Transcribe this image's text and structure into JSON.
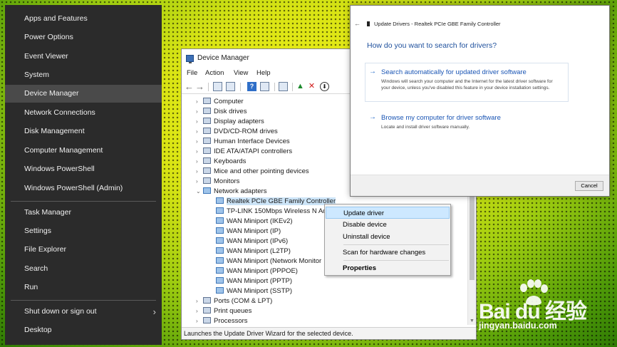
{
  "winx_menu": {
    "items": [
      {
        "label": "Apps and Features"
      },
      {
        "label": "Power Options"
      },
      {
        "label": "Event Viewer"
      },
      {
        "label": "System"
      },
      {
        "label": "Device Manager"
      },
      {
        "label": "Network Connections"
      },
      {
        "label": "Disk Management"
      },
      {
        "label": "Computer Management"
      },
      {
        "label": "Windows PowerShell"
      },
      {
        "label": "Windows PowerShell (Admin)"
      },
      {
        "label": "Task Manager"
      },
      {
        "label": "Settings"
      },
      {
        "label": "File Explorer"
      },
      {
        "label": "Search"
      },
      {
        "label": "Run"
      },
      {
        "label": "Shut down or sign out"
      },
      {
        "label": "Desktop"
      }
    ],
    "active_item": "Device Manager"
  },
  "device_manager": {
    "title": "Device Manager",
    "menu": [
      "File",
      "Action",
      "View",
      "Help"
    ],
    "tree": [
      {
        "label": "Computer",
        "expander": "›"
      },
      {
        "label": "Disk drives",
        "expander": "›"
      },
      {
        "label": "Display adapters",
        "expander": "›"
      },
      {
        "label": "DVD/CD-ROM drives",
        "expander": "›"
      },
      {
        "label": "Human Interface Devices",
        "expander": "›"
      },
      {
        "label": "IDE ATA/ATAPI controllers",
        "expander": "›"
      },
      {
        "label": "Keyboards",
        "expander": "›"
      },
      {
        "label": "Mice and other pointing devices",
        "expander": "›"
      },
      {
        "label": "Monitors",
        "expander": "›"
      },
      {
        "label": "Network adapters",
        "expander": "⌄"
      },
      {
        "label": "Realtek PCIe GBE Family Controller",
        "child": true
      },
      {
        "label": "TP-LINK 150Mbps Wireless N Ada",
        "child": true
      },
      {
        "label": "WAN Miniport (IKEv2)",
        "child": true
      },
      {
        "label": "WAN Miniport (IP)",
        "child": true
      },
      {
        "label": "WAN Miniport (IPv6)",
        "child": true
      },
      {
        "label": "WAN Miniport (L2TP)",
        "child": true
      },
      {
        "label": "WAN Miniport (Network Monitor",
        "child": true
      },
      {
        "label": "WAN Miniport (PPPOE)",
        "child": true
      },
      {
        "label": "WAN Miniport (PPTP)",
        "child": true
      },
      {
        "label": "WAN Miniport (SSTP)",
        "child": true
      },
      {
        "label": "Ports (COM & LPT)",
        "expander": "›"
      },
      {
        "label": "Print queues",
        "expander": "›"
      },
      {
        "label": "Processors",
        "expander": "›"
      }
    ],
    "selected_item": "Realtek PCIe GBE Family Controller",
    "status_text": "Launches the Update Driver Wizard for the selected device."
  },
  "context_menu": {
    "items": [
      {
        "label": "Update driver"
      },
      {
        "label": "Disable device"
      },
      {
        "label": "Uninstall device"
      },
      {
        "label": "Scan for hardware changes"
      },
      {
        "label": "Properties"
      }
    ],
    "highlighted": "Update driver"
  },
  "update_dialog": {
    "title": "Update Drivers - Realtek PCIe GBE Family Controller",
    "question": "How do you want to search for drivers?",
    "option_auto": {
      "title": "Search automatically for updated driver software",
      "description": "Windows will search your computer and the Internet for the latest driver software for your device, unless you've disabled this feature in your device installation settings."
    },
    "option_browse": {
      "title": "Browse my computer for driver software",
      "description": "Locate and install driver software manually."
    },
    "cancel_label": "Cancel"
  },
  "watermark": {
    "brand": "Bai du 经验",
    "url": "jingyan.baidu.com"
  },
  "colors": {
    "menu_bg": "#2b2b2b",
    "link_blue": "#1a55b4",
    "selection": "#cce4f7"
  }
}
